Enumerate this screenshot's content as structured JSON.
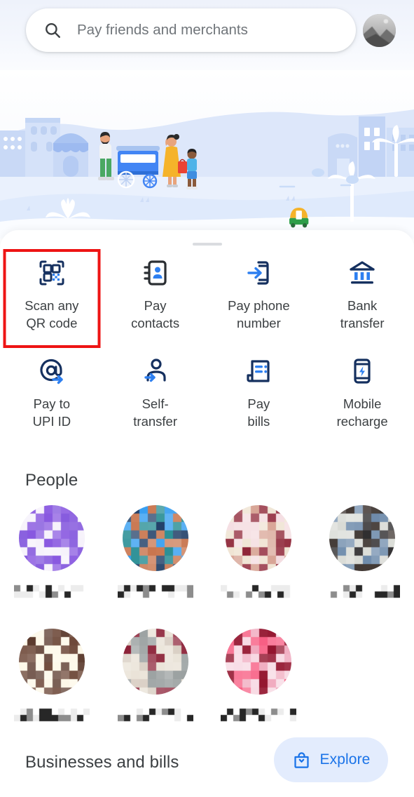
{
  "app": {
    "accent_blue": "#1a73e8",
    "icon_navy": "#15305f",
    "highlight_red": "#ee1414",
    "sheet_bg": "#ffffff"
  },
  "header": {
    "search": {
      "icon": "search-icon",
      "placeholder": "Pay friends and merchants",
      "value": ""
    },
    "avatar": {
      "icon": "avatar",
      "label": "Profile"
    }
  },
  "hero": {
    "icon": "city-street-illustration",
    "description": "Illustration of a street with shops, buildings, palm trees, an auto-rickshaw and a family at a food cart"
  },
  "sheet": {
    "grabber": "drag-handle",
    "actions": [
      {
        "id": "scan-qr",
        "icon": "qr-code-icon",
        "label": "Scan any\nQR code",
        "line1": "Scan any",
        "line2": "QR code",
        "highlighted": true
      },
      {
        "id": "pay-contacts",
        "icon": "contacts-icon",
        "label": "Pay\ncontacts",
        "line1": "Pay",
        "line2": "contacts",
        "highlighted": false
      },
      {
        "id": "pay-phone",
        "icon": "phone-arrow-icon",
        "label": "Pay phone\nnumber",
        "line1": "Pay phone",
        "line2": "number",
        "highlighted": false
      },
      {
        "id": "bank-transfer",
        "icon": "bank-icon",
        "label": "Bank\ntransfer",
        "line1": "Bank",
        "line2": "transfer",
        "highlighted": false
      },
      {
        "id": "pay-upi-id",
        "icon": "at-arrow-icon",
        "label": "Pay to\nUPI ID",
        "line1": "Pay to",
        "line2": "UPI ID",
        "highlighted": false
      },
      {
        "id": "self-transfer",
        "icon": "person-arrow-icon",
        "label": "Self-\ntransfer",
        "line1": "Self-",
        "line2": "transfer",
        "highlighted": false
      },
      {
        "id": "pay-bills",
        "icon": "bill-icon",
        "label": "Pay\nbills",
        "line1": "Pay",
        "line2": "bills",
        "highlighted": false
      },
      {
        "id": "mobile-recharge",
        "icon": "phone-bolt-icon",
        "label": "Mobile\nrecharge",
        "line1": "Mobile",
        "line2": "recharge",
        "highlighted": false
      }
    ],
    "people": {
      "title": "People",
      "contacts": [
        {
          "id": "person-1",
          "avatar": "pixelated-avatar",
          "name_redacted": true,
          "avatar_colors": [
            "#7c4ddb",
            "#8857e0",
            "#f6f2fb"
          ]
        },
        {
          "id": "person-2",
          "avatar": "pixelated-avatar",
          "name_redacted": true,
          "avatar_colors": [
            "#2a8f95",
            "#1b3a63",
            "#c9764f",
            "#2f9bf0"
          ]
        },
        {
          "id": "person-3",
          "avatar": "pixelated-avatar",
          "name_redacted": true,
          "avatar_colors": [
            "#efe3d2",
            "#8e2436",
            "#d8a596",
            "#f4dce0"
          ]
        },
        {
          "id": "person-4",
          "avatar": "pixelated-avatar",
          "name_redacted": true,
          "avatar_colors": [
            "#d9dbd6",
            "#3d3430",
            "#1c1a1c",
            "#6e8bab"
          ]
        },
        {
          "id": "person-5",
          "avatar": "pixelated-avatar",
          "name_redacted": true,
          "avatar_colors": [
            "#6b4535",
            "#fdf8e8",
            "#5a392c"
          ]
        },
        {
          "id": "person-6",
          "avatar": "pixelated-avatar",
          "name_redacted": true,
          "avatar_colors": [
            "#d9cfc4",
            "#8c2238",
            "#9aa0a0",
            "#e9e2d6"
          ]
        },
        {
          "id": "person-7",
          "avatar": "pixelated-avatar",
          "name_redacted": true,
          "avatar_colors": [
            "#f0a8bd",
            "#93142e",
            "#f75e83",
            "#f7d8e2"
          ]
        }
      ]
    },
    "businesses": {
      "title": "Businesses and bills",
      "explore_button": {
        "icon": "shopping-bag-icon",
        "label": "Explore"
      }
    }
  }
}
